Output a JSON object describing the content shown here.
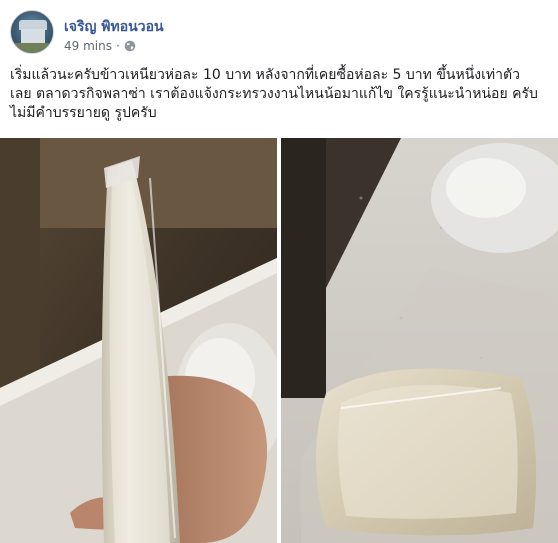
{
  "post": {
    "author": "เจริญ พิทอนวอน",
    "time": "49 mins",
    "privacy_icon": "globe-icon",
    "lines": [
      "เริ่มแล้วนะครับข้าวเหนียวห่อละ 10 บาท หลังจากที่เคยซื้อห่อละ 5 บาท ขึ้นหนึ่งเท่าตัว",
      "เลย ตลาดวรกิจพลาซ่า เราต้องแจ้งกระทรวงงานไหนน้อมาแก้ไข ใครรู้แนะนำหน่อย ครับ",
      "ไม่มีคำบรรยายดู รูปครับ"
    ]
  },
  "colors": {
    "author_link": "#385898",
    "meta_text": "#606770",
    "body_text": "#1c1e21"
  }
}
